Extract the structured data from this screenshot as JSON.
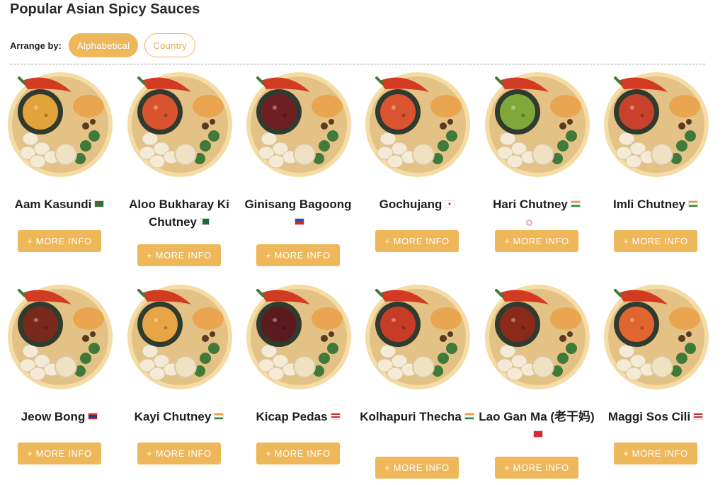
{
  "page": {
    "title": "Popular Asian Spicy Sauces",
    "arrange_label": "Arrange by:",
    "arrange_options": [
      {
        "label": "Alphabetical",
        "active": true
      },
      {
        "label": "Country",
        "active": false
      }
    ]
  },
  "colors": {
    "accent": "#edb75a",
    "plate": "#e4c184",
    "plate_rim": "#f5dca4",
    "bowl": "#2f3b2e"
  },
  "sauces": [
    {
      "name": "Aam Kasundi",
      "flag": "bangladesh-flag",
      "sauce_color": "#e2a43a",
      "button": "+ MORE INFO"
    },
    {
      "name": "Aloo Bukharay Ki Chutney",
      "flag": "pakistan-flag",
      "sauce_color": "#d9532e",
      "button": "+ MORE INFO"
    },
    {
      "name": "Ginisang Bagoong",
      "flag": "philippines-flag",
      "sauce_color": "#6e1f22",
      "button": "+ MORE INFO"
    },
    {
      "name": "Gochujang",
      "flag": "korea-flag",
      "sauce_color": "#d9542f",
      "button": "+ MORE INFO"
    },
    {
      "name": "Hari Chutney",
      "flag": "india-flag",
      "sauce_color": "#7fa83a",
      "button": "+ MORE INFO"
    },
    {
      "name": "Imli Chutney",
      "flag": "india-flag",
      "sauce_color": "#c8412b",
      "button": "+ MORE INFO"
    },
    {
      "name": "Jeow Bong",
      "flag": "laos-flag",
      "sauce_color": "#7a2a1c",
      "button": "+ MORE INFO"
    },
    {
      "name": "Kayi Chutney",
      "flag": "india-flag",
      "sauce_color": "#e7a545",
      "button": "+ MORE INFO"
    },
    {
      "name": "Kicap Pedas",
      "flag": "malaysia-flag",
      "sauce_color": "#5a1a1e",
      "button": "+ MORE INFO"
    },
    {
      "name": "Kolhapuri Thecha",
      "flag": "india-flag",
      "sauce_color": "#c63c26",
      "button": "+ MORE INFO"
    },
    {
      "name": "Lao Gan Ma (老干妈)",
      "flag": "china-flag",
      "sauce_color": "#8b2a18",
      "button": "+ MORE INFO"
    },
    {
      "name": "Maggi Sos Cili",
      "flag": "malaysia-flag",
      "sauce_color": "#e0652f",
      "button": "+ MORE INFO"
    }
  ]
}
